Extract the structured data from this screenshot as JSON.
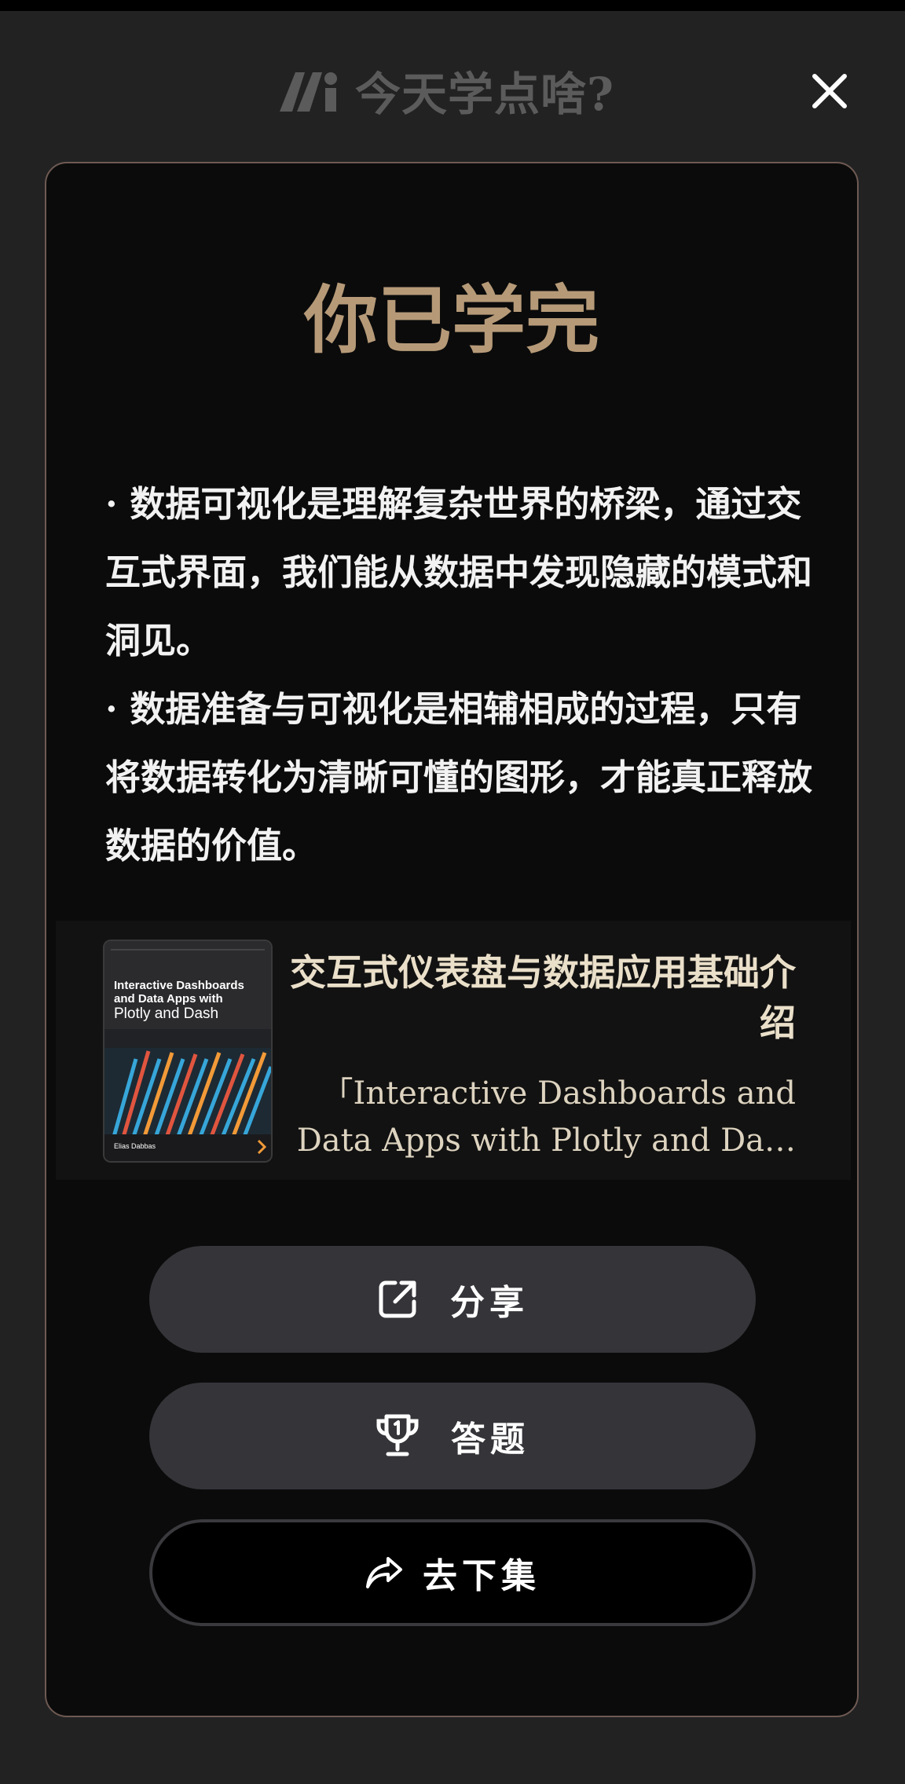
{
  "header": {
    "brand_text": "今天学点啥?"
  },
  "card": {
    "title": "你已学完",
    "summary": [
      "· 数据可视化是理解复杂世界的桥梁，通过交互式界面，我们能从数据中发现隐藏的模式和洞见。",
      "· 数据准备与可视化是相辅相成的过程，只有将数据转化为清晰可懂的图形，才能真正释放数据的价值。"
    ],
    "book": {
      "title": "交互式仪表盘与数据应用基础介绍",
      "subtitle_line1": "「Interactive Dashboards and",
      "subtitle_line2": "Data Apps with Plotly and Da…",
      "cover": {
        "title_line1": "Interactive Dashboards",
        "title_line2": "and Data Apps with",
        "title_line3": "Plotly and Dash",
        "author": "Elias Dabbas"
      }
    },
    "buttons": {
      "share_label": "分享",
      "quiz_label": "答题",
      "next_label": "去下集"
    }
  },
  "colors": {
    "background": "#222223",
    "card_background": "#0b0b0b",
    "card_border": "#6e5a53",
    "title_gold": "#b69a78",
    "button_gray": "#343439"
  },
  "icons": {
    "brand": "brand-logo-icon",
    "close": "close-icon",
    "share": "share-external-icon",
    "quiz": "trophy-icon",
    "next": "forward-arrow-icon"
  }
}
